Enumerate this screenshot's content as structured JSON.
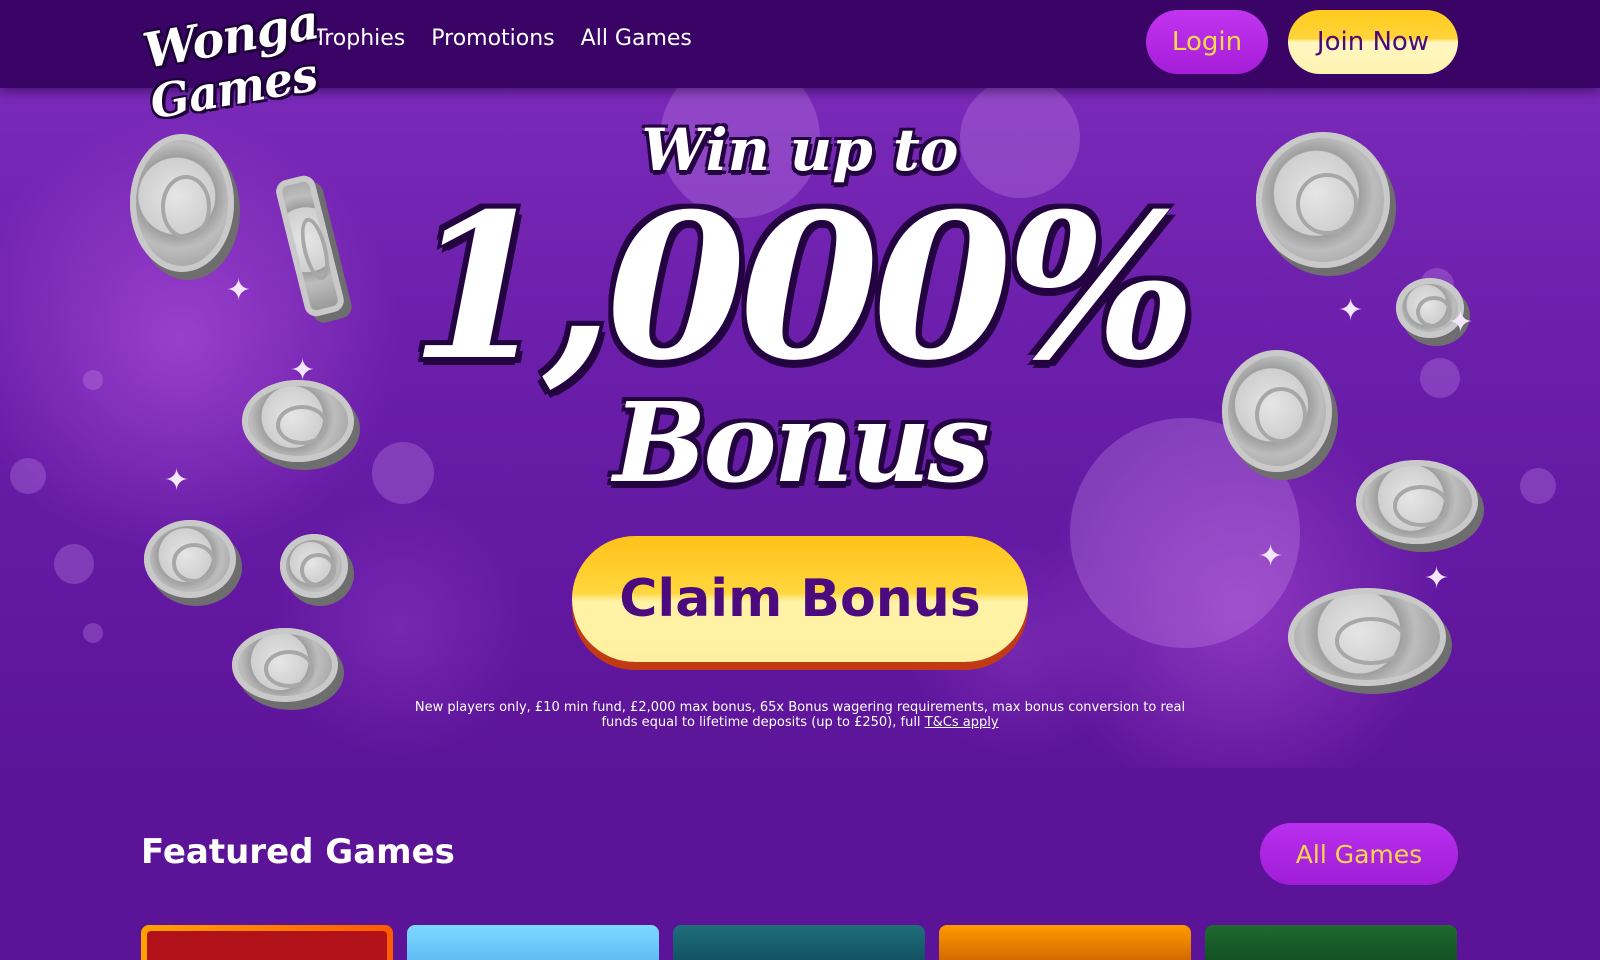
{
  "header": {
    "logo_line1": "Wonga",
    "logo_line2": "Games",
    "nav": [
      {
        "label": "Trophies"
      },
      {
        "label": "Promotions"
      },
      {
        "label": "All Games"
      }
    ],
    "login_label": "Login",
    "join_label": "Join Now"
  },
  "hero": {
    "line1": "Win up to",
    "line2": "1,000%",
    "line3": "Bonus",
    "cta_label": "Claim Bonus",
    "terms_text": "New players only, £10 min fund, £2,000 max bonus, 65x Bonus wagering requirements, max bonus conversion to real funds equal to lifetime deposits (up to £250), full ",
    "terms_link": "T&Cs apply"
  },
  "featured": {
    "title": "Featured Games",
    "all_games_label": "All Games",
    "tiles": [
      {
        "name": "game-tile-1"
      },
      {
        "name": "game-tile-2"
      },
      {
        "name": "game-tile-3"
      },
      {
        "name": "game-tile-4"
      },
      {
        "name": "game-tile-5"
      }
    ]
  },
  "colors": {
    "header_bg": "#3a0466",
    "hero_bg": "#6a1eaa",
    "accent_yellow": "#ffd43a",
    "accent_purple": "#a51dd8",
    "cta_text": "#4b0a7d"
  }
}
